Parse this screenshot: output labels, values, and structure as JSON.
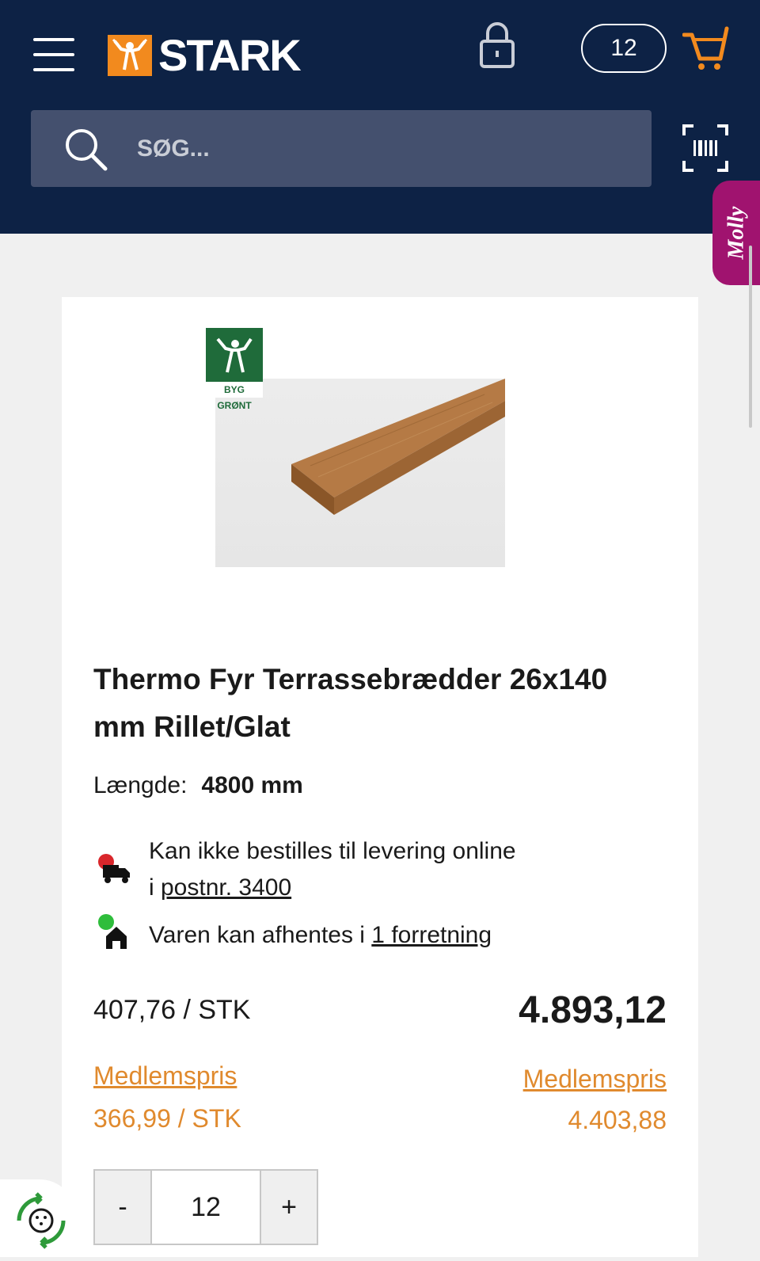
{
  "header": {
    "logo_text": "STARK",
    "cart_count": "12",
    "search_placeholder": "SØG...",
    "molly_label": "Molly"
  },
  "product": {
    "badge_text": "BYG GRØNT",
    "title": "Thermo Fyr Terrassebrædder 26x140 mm Rillet/Glat",
    "length_label": "Længde:",
    "length_value": "4800 mm",
    "delivery_text": "Kan ikke bestilles til levering online",
    "delivery_prefix": "i ",
    "delivery_link": "postnr. 3400",
    "pickup_text": "Varen kan afhentes i ",
    "pickup_link": "1 forretning",
    "unit_price": "407,76 / STK",
    "total_price": "4.893,12",
    "member_label": "Medlemspris",
    "member_unit_price": "366,99 / STK",
    "member_total_price": "4.403,88",
    "quantity": "12",
    "qty_minus": "-",
    "qty_plus": "+"
  },
  "colors": {
    "header_bg": "#0d2245",
    "brand_orange": "#f28a1e",
    "member_orange": "#e08a2e",
    "molly_magenta": "#a0136f",
    "status_red": "#d9262b",
    "status_green": "#2ebd3b"
  },
  "icons": [
    "menu-icon",
    "stark-logo-icon",
    "lock-icon",
    "cart-icon",
    "search-icon",
    "barcode-scan-icon",
    "delivery-truck-icon",
    "store-house-icon",
    "eco-recycle-icon"
  ]
}
